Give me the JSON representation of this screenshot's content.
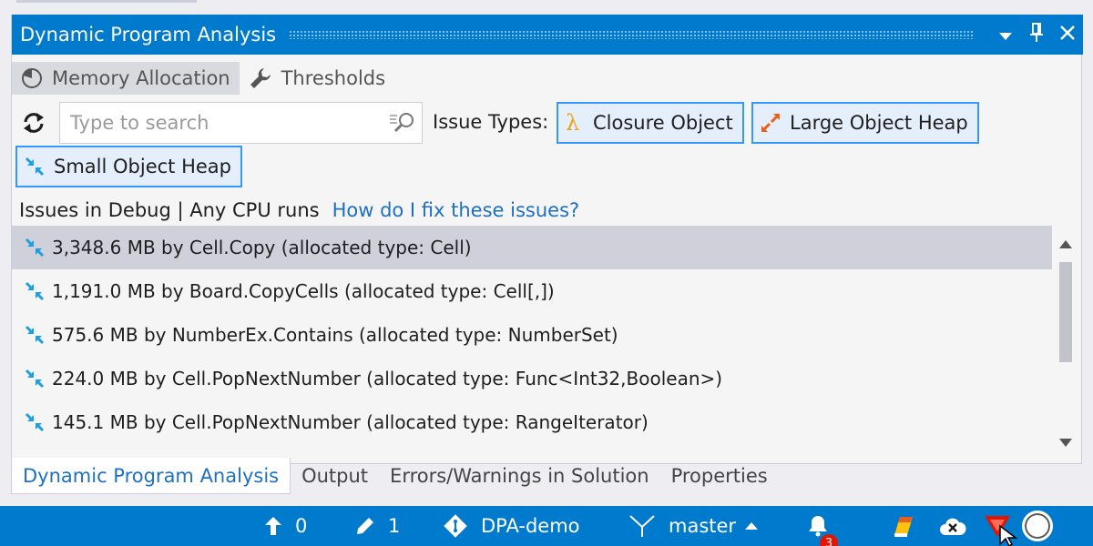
{
  "panel": {
    "title": "Dynamic Program Analysis",
    "window_controls": [
      "chevron-down-icon",
      "pin-icon",
      "close-icon"
    ]
  },
  "tabs": [
    {
      "label": "Memory Allocation",
      "icon": "pie-chart-icon",
      "active": true
    },
    {
      "label": "Thresholds",
      "icon": "wrench-icon",
      "active": false
    }
  ],
  "toolbar": {
    "search_placeholder": "Type to search",
    "search_value": "",
    "issue_types_label": "Issue Types:",
    "chips": [
      {
        "label": "Closure Object",
        "icon": "lambda-icon",
        "color": "#E8A317"
      },
      {
        "label": "Large Object Heap",
        "icon": "expand-arrows-icon",
        "color": "#E8601C"
      },
      {
        "label": "Small Object Heap",
        "icon": "compress-arrows-icon",
        "color": "#1BA1E2"
      }
    ]
  },
  "summary": {
    "text": "Issues in Debug | Any CPU runs",
    "link": "How do I fix these issues?"
  },
  "issues": [
    {
      "text": "3,348.6 MB by Cell.Copy (allocated type: Cell)",
      "selected": true
    },
    {
      "text": "1,191.0 MB by Board.CopyCells (allocated type: Cell[,])",
      "selected": false
    },
    {
      "text": "575.6 MB by NumberEx.Contains (allocated type: NumberSet)",
      "selected": false
    },
    {
      "text": "224.0 MB by Cell.PopNextNumber (allocated type: Func<Int32,Boolean>)",
      "selected": false
    },
    {
      "text": "145.1 MB by Cell.PopNextNumber (allocated type: RangeIterator)",
      "selected": false
    }
  ],
  "bottom_tabs": [
    {
      "label": "Dynamic Program Analysis",
      "active": true
    },
    {
      "label": "Output",
      "active": false
    },
    {
      "label": "Errors/Warnings in Solution",
      "active": false
    },
    {
      "label": "Properties",
      "active": false
    }
  ],
  "statusbar": {
    "push_count": "0",
    "edit_count": "1",
    "repo": "DPA-demo",
    "branch": "master",
    "notifications": "3"
  },
  "colors": {
    "accent": "#007ACC",
    "selection": "#CFD0DA",
    "link": "#1E70C0"
  }
}
